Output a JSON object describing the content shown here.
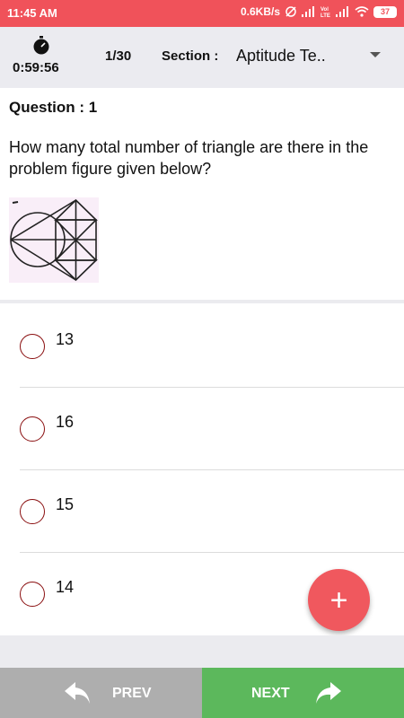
{
  "status_bar": {
    "time": "11:45 AM",
    "net_speed": "0.6KB/s",
    "battery": "37"
  },
  "header": {
    "timer": "0:59:56",
    "question_count": "1/30",
    "section_label": "Section :",
    "section_value": "Aptitude Te.."
  },
  "question": {
    "header": "Question : 1",
    "text": "How many total number of triangle are there in the problem figure given below?"
  },
  "options": [
    {
      "label": "13"
    },
    {
      "label": "16"
    },
    {
      "label": "15"
    },
    {
      "label": "14"
    }
  ],
  "fab": {
    "label": "+"
  },
  "footer": {
    "prev_label": "PREV",
    "next_label": "NEXT"
  },
  "colors": {
    "status_bar": "#f0525a",
    "fab": "#f0585e",
    "prev": "#aeaeae",
    "next": "#5cb85c",
    "radio": "#8a0f10"
  }
}
